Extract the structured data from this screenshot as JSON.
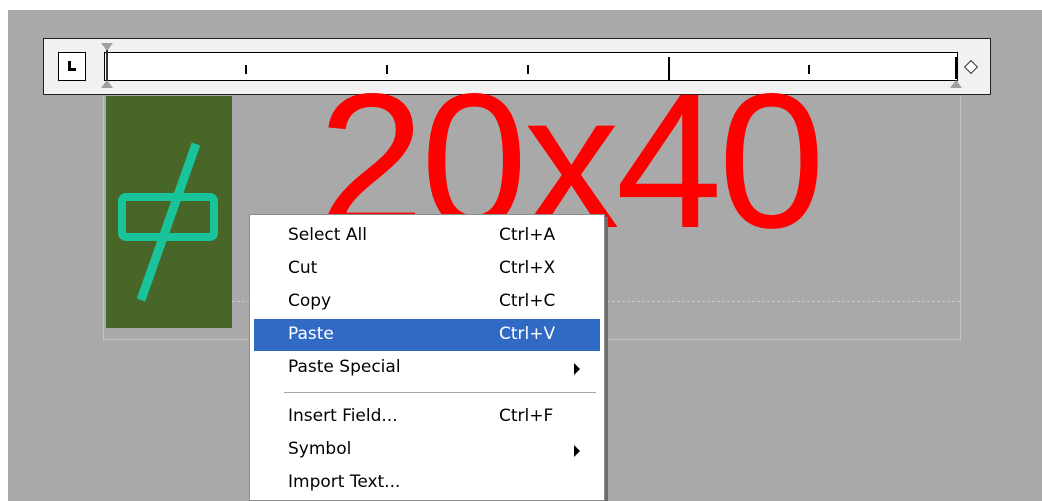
{
  "document": {
    "big_text": "20x40",
    "icon_name": "diameter-symbol-icon",
    "icon_panel_color": "#486628",
    "icon_color": "#19c49a",
    "text_color": "#ff0000"
  },
  "ruler": {
    "tab_selector_icon": "left-tab-stop-icon",
    "tab_selector_glyph": "L"
  },
  "context_menu": {
    "selected_item": "Paste",
    "selection_color": "#316ac5",
    "items": [
      {
        "label": "Select All",
        "shortcut": "Ctrl+A",
        "submenu": false
      },
      {
        "label": "Cut",
        "shortcut": "Ctrl+X",
        "submenu": false
      },
      {
        "label": "Copy",
        "shortcut": "Ctrl+C",
        "submenu": false
      },
      {
        "label": "Paste",
        "shortcut": "Ctrl+V",
        "submenu": false
      },
      {
        "label": "Paste Special",
        "shortcut": "",
        "submenu": true
      },
      {
        "label": "Insert Field...",
        "shortcut": "Ctrl+F",
        "submenu": false
      },
      {
        "label": "Symbol",
        "shortcut": "",
        "submenu": true
      },
      {
        "label": "Import Text...",
        "shortcut": "",
        "submenu": false
      }
    ]
  }
}
